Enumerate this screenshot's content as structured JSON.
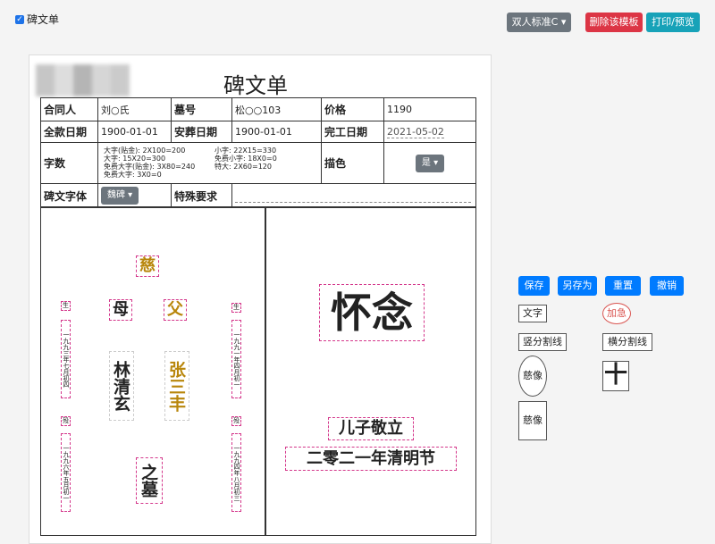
{
  "header": {
    "checkbox_label": "碑文单",
    "template_select": "双人标准C",
    "delete_template": "删除该模板",
    "print_preview": "打印/预览"
  },
  "doc": {
    "title": "碑文单",
    "contract_label": "合同人",
    "contract_value": "刘○氏",
    "grave_label": "墓号",
    "grave_value": "松○○103",
    "price_label": "价格",
    "price_value": "1190",
    "pay_label": "全款日期",
    "pay_value": "1900-01-01",
    "burial_label": "安葬日期",
    "burial_value": "1900-01-01",
    "finish_label": "完工日期",
    "finish_value": "2021-05-02",
    "count_label": "字数",
    "count_lines_left": [
      "大字(贴金): 2X100=200",
      "大字: 15X20=300",
      "免费大字(贴金): 3X80=240",
      "免费大字: 3X0=0"
    ],
    "count_lines_right": [
      "小字: 22X15=330",
      "免费小字: 18X0=0",
      "特大: 2X60=120"
    ],
    "paint_label": "描色",
    "paint_value": "是",
    "font_label": "碑文字体",
    "font_value": "魏碑",
    "special_label": "特殊要求",
    "special_value": ""
  },
  "left_tablet": {
    "top_char": "慈",
    "mother": "母",
    "father": "父",
    "mother_name": "林清玄",
    "father_name": "张三丰",
    "grave": "之墓",
    "left_birth_mark": "生",
    "left_birth": "一九九三年七月初四",
    "left_death_mark": "殁",
    "left_death": "一九九六年五月初一",
    "right_birth_mark": "生",
    "right_birth": "一九九一年四月初一",
    "right_death_mark": "殁",
    "right_death": "一九九四年八月初三"
  },
  "right_tablet": {
    "main": "怀念",
    "sign": "儿子敬立",
    "date": "二零二一年清明节"
  },
  "tools": {
    "save": "保存",
    "save_as": "另存为",
    "reset": "重置",
    "undo": "撤销",
    "text": "文字",
    "add_urgent": "加急",
    "v_divider": "竖分割线",
    "h_divider": "横分割线",
    "portrait_oval": "慈像",
    "cross": "十",
    "portrait_rect": "慈像"
  }
}
